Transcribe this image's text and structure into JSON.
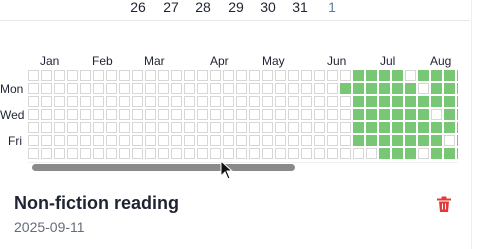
{
  "calendar_strip": {
    "dates": [
      {
        "value": "26",
        "is_next_month": false
      },
      {
        "value": "27",
        "is_next_month": false
      },
      {
        "value": "28",
        "is_next_month": false
      },
      {
        "value": "29",
        "is_next_month": false
      },
      {
        "value": "30",
        "is_next_month": false
      },
      {
        "value": "31",
        "is_next_month": false
      },
      {
        "value": "1",
        "is_next_month": true
      }
    ]
  },
  "heatmap": {
    "months": [
      "Jan",
      "Feb",
      "Mar",
      "Apr",
      "May",
      "Jun",
      "Jul",
      "Aug"
    ],
    "day_labels": [
      "Mon",
      "Wed",
      "Fri"
    ],
    "active_days": [
      [
        30,
        1
      ],
      [
        31,
        0
      ],
      [
        31,
        1
      ],
      [
        31,
        2
      ],
      [
        31,
        3
      ],
      [
        31,
        4
      ],
      [
        31,
        5
      ],
      [
        32,
        0
      ],
      [
        32,
        1
      ],
      [
        32,
        2
      ],
      [
        32,
        3
      ],
      [
        32,
        4
      ],
      [
        32,
        5
      ],
      [
        33,
        0
      ],
      [
        33,
        1
      ],
      [
        33,
        2
      ],
      [
        33,
        3
      ],
      [
        33,
        4
      ],
      [
        33,
        5
      ],
      [
        33,
        6
      ],
      [
        34,
        0
      ],
      [
        34,
        1
      ],
      [
        34,
        2
      ],
      [
        34,
        3
      ],
      [
        34,
        4
      ],
      [
        34,
        5
      ],
      [
        34,
        6
      ],
      [
        35,
        1
      ],
      [
        35,
        2
      ],
      [
        35,
        3
      ],
      [
        35,
        4
      ],
      [
        35,
        5
      ],
      [
        35,
        6
      ],
      [
        36,
        0
      ],
      [
        36,
        2
      ],
      [
        36,
        3
      ],
      [
        36,
        4
      ],
      [
        36,
        5
      ],
      [
        37,
        0
      ],
      [
        37,
        1
      ],
      [
        37,
        2
      ],
      [
        37,
        4
      ],
      [
        37,
        5
      ],
      [
        37,
        6
      ],
      [
        38,
        0
      ],
      [
        38,
        1
      ],
      [
        38,
        2
      ],
      [
        38,
        3
      ],
      [
        38,
        4
      ],
      [
        38,
        6
      ],
      [
        39,
        0
      ],
      [
        39,
        1
      ],
      [
        39,
        2
      ],
      [
        39,
        3
      ],
      [
        39,
        4
      ],
      [
        39,
        5
      ],
      [
        39,
        6
      ]
    ],
    "fill_color": "#77c774",
    "empty_color": "#ffffff",
    "border_color": "#d7d7d7"
  },
  "entry": {
    "title": "Non-fiction reading",
    "date": "2025-09-11",
    "delete_icon_color": "#e53935"
  },
  "scrollbar": {
    "thumb_color": "#8a8a8a"
  }
}
